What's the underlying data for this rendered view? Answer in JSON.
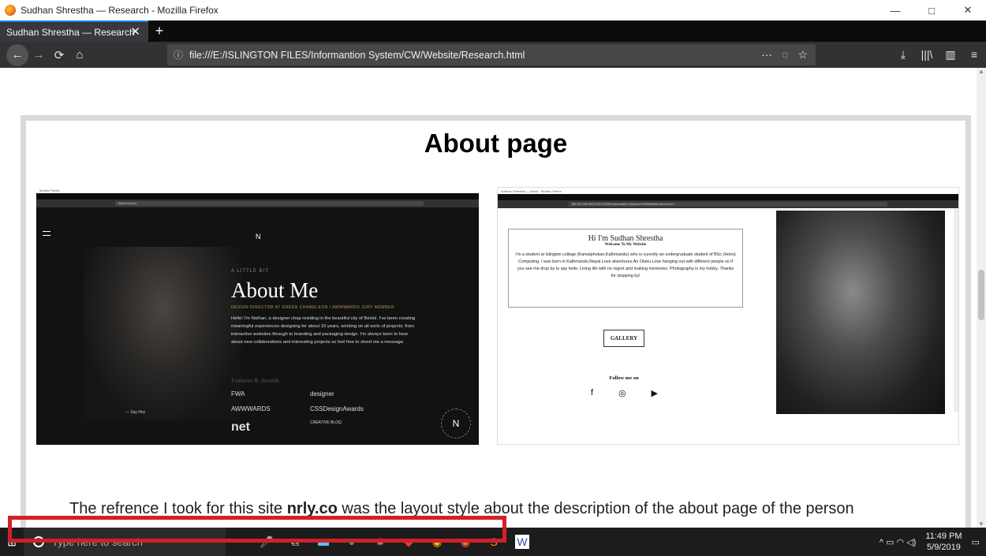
{
  "window": {
    "title": "Sudhan Shrestha — Research - Mozilla Firefox",
    "minimize": "—",
    "maximize": "□",
    "close": "✕"
  },
  "tab": {
    "label": "Sudhan Shrestha — Research",
    "close": "✕",
    "new_tab": "+"
  },
  "nav": {
    "back": "←",
    "forward": "→",
    "reload": "⟳",
    "home": "⌂",
    "info": "ⓘ",
    "url": "file:///E:/ISLINGTON FILES/Informantion System/CW/Website/Research.html",
    "page_actions": "···",
    "pocket": "◌",
    "bookmark": "☆",
    "downloads": "⤓",
    "library": "|||\\",
    "sidebar": "▥",
    "menu": "≡"
  },
  "page": {
    "title": "About page",
    "shot1": {
      "window_title": "Mozilla Firefox",
      "url": "https://nrly.co",
      "logo": "N",
      "label": "A LITTLE BIT",
      "heading": "About Me",
      "role": "DESIGN DIRECTOR AT GREEN CHAMELEON / AWWWARDS JURY MEMBER",
      "para": "Hello! I'm Nathan, a designer chap residing in the beautiful city of Bristol. I've been creating meaningful experiences designing for about 10 years, working on all sorts of projects; from interactive websites through to branding and packaging design. I'm always keen to hear about new collaborations and interesting projects so feel free to shoot me a message.",
      "features": "Features & Awards",
      "logos": [
        "FWA",
        "designer",
        "AWWWARDS",
        "CSSDesignAwards",
        "net",
        "CREATIVE BLOQ"
      ],
      "say_hey": "— Say Hey"
    },
    "shot2": {
      "window_title": "Sudhan Shrestha — About - Mozilla Firefox",
      "url": "file:///E:/ISLINGTON FILES/Informantion System/CW/Website/About.html",
      "card_heading": "Hi I'm Sudhan Shrestha",
      "card_sub": "Welcome To My Website",
      "card_desc": "I'm a student at Islington college (Kamalphokari,Kathmandu) who is curently an undergraduate student of BSc (Hons) Computing. I was born in Kathmandu,Nepal.Love atventures.An Otaku.Love hanging out with different people so if you see me drop by to say hello. Living life with no regret and making memories. Photography is my hobby. Thanks for stopping by!",
      "gallery": "GALLERY",
      "follow": "Follow me on",
      "social": [
        "f",
        "◎",
        "▶"
      ]
    },
    "caption_pre": "The refrence I took for this site ",
    "caption_bold": "nrly.co",
    "caption_post": " was the layout style about the description of the about page of the person"
  },
  "taskbar": {
    "search_placeholder": "Type here to search",
    "time": "11:49 PM",
    "date": "5/9/2019",
    "tray": "^ ▭ ◠ ◁)"
  }
}
